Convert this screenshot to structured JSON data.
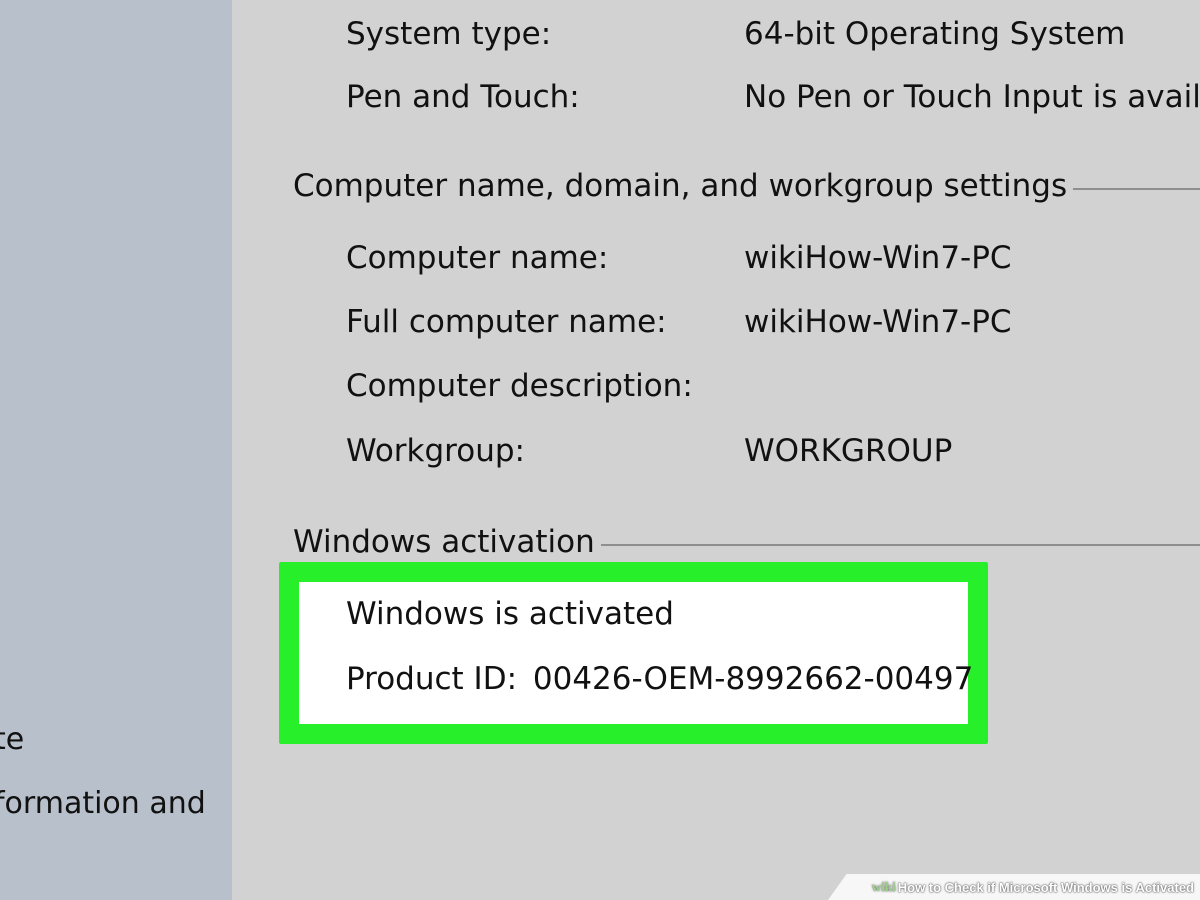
{
  "left_pane": {
    "fragments": [
      "te",
      "formation and"
    ]
  },
  "system": {
    "rows": [
      {
        "label": "System type:",
        "value": "64-bit Operating System"
      },
      {
        "label": "Pen and Touch:",
        "value": "No Pen or Touch Input is availab"
      }
    ]
  },
  "computer_section": {
    "title": "Computer name, domain, and workgroup settings",
    "rows": [
      {
        "label": "Computer name:",
        "value": "wikiHow-Win7-PC"
      },
      {
        "label": "Full computer name:",
        "value": "wikiHow-Win7-PC"
      },
      {
        "label": "Computer description:",
        "value": ""
      },
      {
        "label": "Workgroup:",
        "value": "WORKGROUP"
      }
    ]
  },
  "activation_section": {
    "title": "Windows activation",
    "status": "Windows is activated",
    "product_id_label": "Product ID:",
    "product_id": "00426-OEM-8992662-00497"
  },
  "watermark": {
    "brand": "wiki",
    "text": "How to Check if Microsoft Windows is Activated"
  },
  "colors": {
    "highlight": "#27f02b",
    "left_pane": "#b8c0cb",
    "main_pane": "#d2d2d2"
  }
}
